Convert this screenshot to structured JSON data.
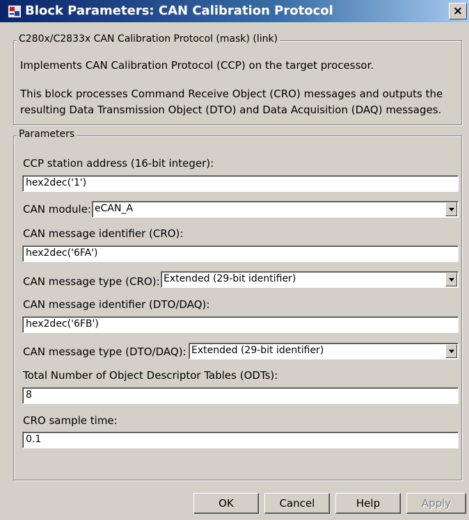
{
  "window": {
    "title": "Block Parameters: CAN Calibration Protocol",
    "close_label": "×"
  },
  "description": {
    "legend": "C280x/C2833x CAN Calibration Protocol (mask) (link)",
    "line1": "Implements CAN Calibration Protocol (CCP) on the target processor.",
    "line2": "This block processes Command Receive Object (CRO) messages and outputs the",
    "line3": "resulting Data Transmission Object (DTO) and Data Acquisition (DAQ) messages."
  },
  "parameters": {
    "legend": "Parameters",
    "station_address": {
      "label": "CCP station address (16-bit integer):",
      "value": "hex2dec('1')"
    },
    "can_module": {
      "label": "CAN module:",
      "value": "eCAN_A"
    },
    "cro_identifier": {
      "label": "CAN message identifier (CRO):",
      "value": "hex2dec('6FA')"
    },
    "cro_type": {
      "label": "CAN message type (CRO):",
      "value": "Extended (29-bit identifier)"
    },
    "dto_identifier": {
      "label": "CAN message identifier (DTO/DAQ):",
      "value": "hex2dec('6FB')"
    },
    "dto_type": {
      "label": "CAN message type (DTO/DAQ):",
      "value": "Extended (29-bit identifier)"
    },
    "odt_count": {
      "label": "Total Number of Object Descriptor Tables (ODTs):",
      "value": "8"
    },
    "sample_time": {
      "label": "CRO sample time:",
      "value": "0.1"
    }
  },
  "buttons": {
    "ok": "OK",
    "cancel": "Cancel",
    "help": "Help",
    "apply": "Apply"
  },
  "colors": {
    "titlebar_start": "#0a246a",
    "titlebar_end": "#a6caf0",
    "dialog_face": "#d4d0c8"
  },
  "icons": {
    "app": "simulink-block-icon",
    "close": "close-icon",
    "dropdown": "chevron-down-icon"
  }
}
